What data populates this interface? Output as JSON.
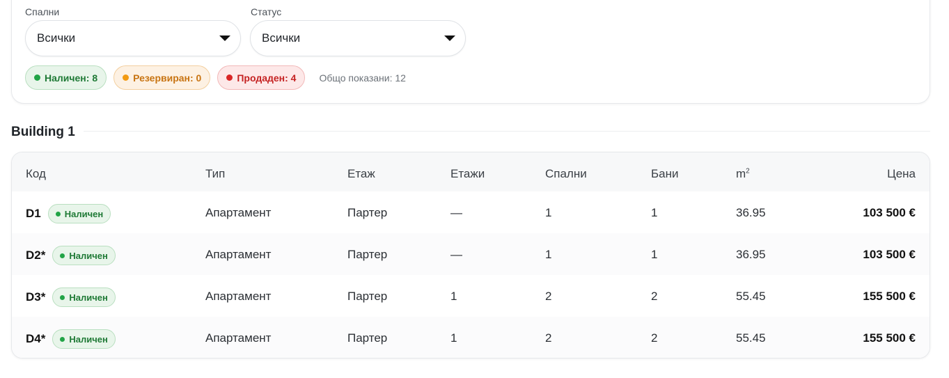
{
  "filters": {
    "bedrooms": {
      "label": "Спални",
      "value": "Всички"
    },
    "status": {
      "label": "Статус",
      "value": "Всички"
    },
    "chips": {
      "available": "Наличен: 8",
      "reserved": "Резервиран: 0",
      "sold": "Продаден: 4"
    },
    "total_shown": "Общо показани: 12"
  },
  "section": {
    "title": "Building 1"
  },
  "table": {
    "headers": {
      "code": "Код",
      "type": "Тип",
      "floor": "Етаж",
      "floors": "Етажи",
      "bedrooms": "Спални",
      "bathrooms": "Бани",
      "area": "m",
      "area_sup": "2",
      "price": "Цена"
    },
    "rows": [
      {
        "code": "D1",
        "status": "Наличен",
        "type": "Апартамент",
        "floor": "Партер",
        "floors": "—",
        "bedrooms": "1",
        "bathrooms": "1",
        "area": "36.95",
        "price": "103 500 €"
      },
      {
        "code": "D2*",
        "status": "Наличен",
        "type": "Апартамент",
        "floor": "Партер",
        "floors": "—",
        "bedrooms": "1",
        "bathrooms": "1",
        "area": "36.95",
        "price": "103 500 €"
      },
      {
        "code": "D3*",
        "status": "Наличен",
        "type": "Апартамент",
        "floor": "Партер",
        "floors": "1",
        "bedrooms": "2",
        "bathrooms": "2",
        "area": "55.45",
        "price": "155 500 €"
      },
      {
        "code": "D4*",
        "status": "Наличен",
        "type": "Апартамент",
        "floor": "Партер",
        "floors": "1",
        "bedrooms": "2",
        "bathrooms": "2",
        "area": "55.45",
        "price": "155 500 €"
      }
    ]
  },
  "colors": {
    "available": "#22a447",
    "reserved": "#f29a12",
    "sold": "#d92626"
  }
}
